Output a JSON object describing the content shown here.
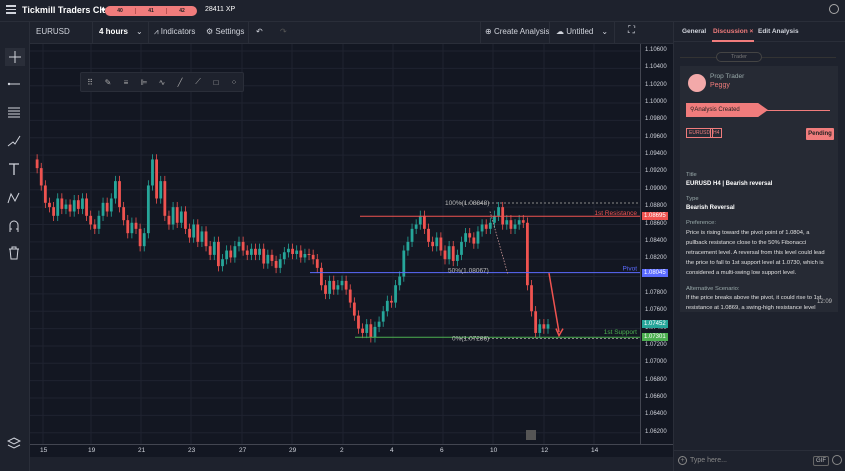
{
  "app": {
    "title": "Tickmill Traders Club",
    "xp_levels": [
      "40",
      "41",
      "42"
    ],
    "xp": "28411 XP"
  },
  "toolbar": {
    "symbol": "EURUSD",
    "interval": "4 hours",
    "indicators_label": "Indicators",
    "settings_label": "Settings",
    "create_label": "Create Analysis",
    "layout_name": "Untitled"
  },
  "chart": {
    "price_ticks": [
      "1.10600",
      "1.10400",
      "1.10200",
      "1.10000",
      "1.09800",
      "1.09600",
      "1.09400",
      "1.09200",
      "1.09000",
      "1.08800",
      "1.08600",
      "1.08400",
      "1.08200",
      "1.08000",
      "1.07800",
      "1.07600",
      "1.07400",
      "1.07200",
      "1.07000",
      "1.06800",
      "1.06600",
      "1.06400",
      "1.06200"
    ],
    "time_ticks": [
      "15",
      "19",
      "21",
      "23",
      "27",
      "29",
      "2",
      "4",
      "6",
      "10",
      "12",
      "14"
    ],
    "fib_100": "100%(1.08848)",
    "fib_50": "50%(1.08067)",
    "fib_0": "0%(1.07286)",
    "resistance_label": "1st Resistance",
    "resistance_price": "1.08695",
    "pivot_label": "Pivot",
    "pivot_price": "1.08045",
    "support_label": "1st Support",
    "support_price": "1.07301",
    "last_price": "1.07452",
    "colors": {
      "up": "#26a69a",
      "down": "#ef5350",
      "resistance": "#ef5350",
      "pivot": "#5b6bff",
      "support": "#4caf50"
    }
  },
  "panel": {
    "tabs": [
      "General",
      "Discussion",
      "Edit Analysis"
    ],
    "trader_pill": "Trader",
    "role": "Prop Trader",
    "username": "Peggy",
    "banner": "Analysis Created",
    "badges": [
      "EURUSD",
      "H4"
    ],
    "status": "Pending",
    "title_label": "Title",
    "title_value": "EURUSD H4 | Bearish reversal",
    "type_label": "Type",
    "type_value": "Bearish Reversal",
    "pref_label": "Preference:",
    "pref_text": "Price is rising toward the pivot point of 1.0804, a pullback resistance close to the 50% Fibonacci retracement level. A reversal from this level could lead the price to fall to 1st  support level at 1.0730, which is considered a multi-swing low support level.",
    "alt_label": "Alternative Scenario:",
    "alt_text": "If the price breaks above the pivot, it could rise to 1st resistance at 1.0869, a swing-high resistance level",
    "time": "12:09",
    "input_placeholder": "Type here...",
    "gif_label": "GIF"
  }
}
